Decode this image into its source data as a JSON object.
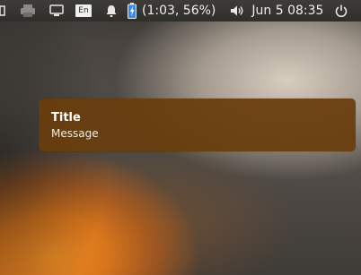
{
  "panel": {
    "icons": {
      "app_indicator": "window-indicator-icon",
      "printer": "printer-icon",
      "display": "display-icon",
      "messaging": "bell-icon",
      "battery": "battery-charging-icon",
      "sound": "speaker-icon",
      "session": "power-icon"
    },
    "keyboard_layout": "En",
    "battery_status": "(1:03, 56%)",
    "clock": "Jun  5 08:35",
    "colors": {
      "panel_bg": "#2f2e2b",
      "battery_accent": "#3d8be0"
    }
  },
  "notification": {
    "title": "Title",
    "message": "Message",
    "background": "#693e0e"
  }
}
